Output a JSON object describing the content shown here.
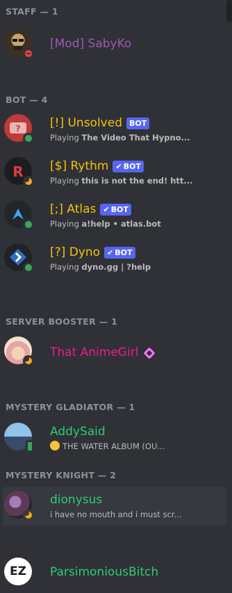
{
  "colors": {
    "background": "#2f3136",
    "mod": "#9b59b6",
    "bot_name": "#f1c40f",
    "booster": "#e91e8c",
    "gladiator": "#2ecc71",
    "knight": "#2ecc71",
    "bot_tag": "#5865f2"
  },
  "sections": {
    "staff": "STAFF — 1",
    "bot": "BOT — 4",
    "booster": "SERVER BOOSTER — 1",
    "gladiator": "MYSTERY GLADIATOR — 1",
    "knight": "MYSTERY KNIGHT — 2"
  },
  "members": {
    "saby": {
      "name": "[Mod] SabyKo",
      "status": "dnd"
    },
    "unsolved": {
      "name": "[!] Unsolved",
      "bot_tag": "BOT",
      "activity_prefix": "Playing ",
      "activity": "The Video That Hypno...",
      "status": "online"
    },
    "rythm": {
      "name": "[$] Rythm",
      "bot_tag": "BOT",
      "activity_prefix": "Playing ",
      "activity": "this is not the end! htt...",
      "status": "idle"
    },
    "atlas": {
      "name": "[;] Atlas",
      "bot_tag": "BOT",
      "activity_prefix": "Playing ",
      "activity": "a!help • atlas.bot",
      "status": "online"
    },
    "dyno": {
      "name": "[?] Dyno",
      "bot_tag": "BOT",
      "activity_prefix": "Playing ",
      "activity": "dyno.gg | ?help",
      "status": "online"
    },
    "animegirl": {
      "name": "That AnimeGirl",
      "status": "idle",
      "badge": "boost-icon"
    },
    "addysaid": {
      "name": "AddySaid",
      "activity": "THE WATER ALBUM (OU...",
      "status": "mobile"
    },
    "dionysus": {
      "name": "dionysus",
      "activity": "i have no mouth and i must scr...",
      "status": "idle"
    },
    "parsimonious": {
      "name": "ParsimoniousBitch",
      "avatar_text": "EZ",
      "status": "none"
    }
  }
}
